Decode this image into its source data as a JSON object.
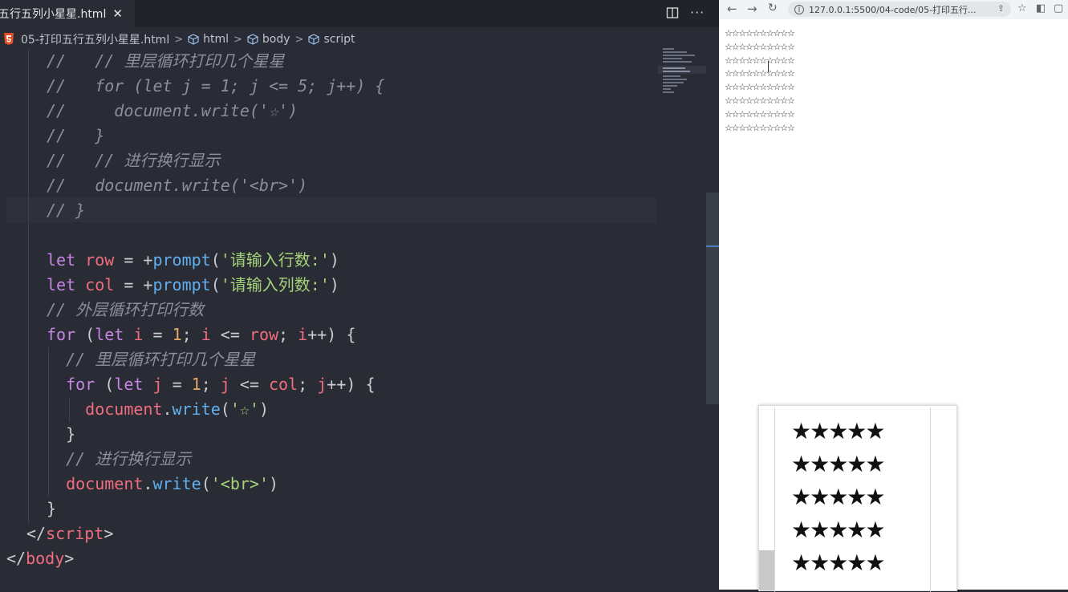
{
  "editor": {
    "tab": {
      "title": "五行五列小星星.html",
      "close": "✕"
    },
    "more": "···",
    "breadcrumb": [
      "05-打印五行五列小星星.html",
      "html",
      "body",
      "script"
    ],
    "code": [
      {
        "parts": [
          [
            "cmt",
            "//   // 里层循环打印几个星星"
          ]
        ]
      },
      {
        "parts": [
          [
            "cmt",
            "//   for (let j = 1; j <= 5; j++) {"
          ]
        ]
      },
      {
        "parts": [
          [
            "cmt",
            "//     document.write('☆')"
          ]
        ]
      },
      {
        "parts": [
          [
            "cmt",
            "//   }"
          ]
        ]
      },
      {
        "parts": [
          [
            "cmt",
            "//   // 进行换行显示"
          ]
        ]
      },
      {
        "parts": [
          [
            "cmt",
            "//   document.write('<br>')"
          ]
        ]
      },
      {
        "parts": [
          [
            "cmt",
            "// }"
          ]
        ]
      },
      {
        "parts": []
      },
      {
        "parts": [
          [
            "kw",
            "let"
          ],
          [
            "op",
            " "
          ],
          [
            "var",
            "row"
          ],
          [
            "op",
            " = +"
          ],
          [
            "fn",
            "prompt"
          ],
          [
            "punc",
            "("
          ],
          [
            "str",
            "'请输入行数:'"
          ],
          [
            "punc",
            ")"
          ]
        ]
      },
      {
        "parts": [
          [
            "kw",
            "let"
          ],
          [
            "op",
            " "
          ],
          [
            "var",
            "col"
          ],
          [
            "op",
            " = +"
          ],
          [
            "fn",
            "prompt"
          ],
          [
            "punc",
            "("
          ],
          [
            "str",
            "'请输入列数:'"
          ],
          [
            "punc",
            ")"
          ]
        ]
      },
      {
        "parts": [
          [
            "cmt",
            "// 外层循环打印行数"
          ]
        ]
      },
      {
        "parts": [
          [
            "kw",
            "for"
          ],
          [
            "punc",
            " ("
          ],
          [
            "kw",
            "let"
          ],
          [
            "op",
            " "
          ],
          [
            "var",
            "i"
          ],
          [
            "op",
            " = "
          ],
          [
            "num",
            "1"
          ],
          [
            "punc",
            "; "
          ],
          [
            "var",
            "i"
          ],
          [
            "op",
            " <= "
          ],
          [
            "var",
            "row"
          ],
          [
            "punc",
            "; "
          ],
          [
            "var",
            "i"
          ],
          [
            "op",
            "++"
          ],
          [
            "punc",
            ") {"
          ]
        ]
      },
      {
        "parts": [
          [
            "cmt",
            "  // 里层循环打印几个星星"
          ]
        ]
      },
      {
        "parts": [
          [
            "op",
            "  "
          ],
          [
            "kw",
            "for"
          ],
          [
            "punc",
            " ("
          ],
          [
            "kw",
            "let"
          ],
          [
            "op",
            " "
          ],
          [
            "var",
            "j"
          ],
          [
            "op",
            " = "
          ],
          [
            "num",
            "1"
          ],
          [
            "punc",
            "; "
          ],
          [
            "var",
            "j"
          ],
          [
            "op",
            " <= "
          ],
          [
            "var",
            "col"
          ],
          [
            "punc",
            "; "
          ],
          [
            "var",
            "j"
          ],
          [
            "op",
            "++"
          ],
          [
            "punc",
            ") {"
          ]
        ]
      },
      {
        "parts": [
          [
            "op",
            "    "
          ],
          [
            "var",
            "document"
          ],
          [
            "punc",
            "."
          ],
          [
            "fn",
            "write"
          ],
          [
            "punc",
            "("
          ],
          [
            "str",
            "'☆'"
          ],
          [
            "punc",
            ")"
          ]
        ]
      },
      {
        "parts": [
          [
            "punc",
            "  }"
          ]
        ]
      },
      {
        "parts": [
          [
            "cmt",
            "  // 进行换行显示"
          ]
        ]
      },
      {
        "parts": [
          [
            "op",
            "  "
          ],
          [
            "var",
            "document"
          ],
          [
            "punc",
            "."
          ],
          [
            "fn",
            "write"
          ],
          [
            "punc",
            "("
          ],
          [
            "str",
            "'<br>'"
          ],
          [
            "punc",
            ")"
          ]
        ]
      },
      {
        "parts": [
          [
            "punc",
            "}"
          ]
        ]
      },
      {
        "parts": [
          [
            "punc",
            "</"
          ],
          [
            "tag",
            "script"
          ],
          [
            "punc",
            ">"
          ]
        ]
      },
      {
        "parts": [
          [
            "punc",
            "</"
          ],
          [
            "tag",
            "body"
          ],
          [
            "punc",
            ">"
          ]
        ]
      }
    ]
  },
  "browser": {
    "url": "127.0.0.1:5500/04-code/05-打印五行...",
    "star_rows": [
      "☆☆☆☆☆☆☆☆☆☆",
      "☆☆☆☆☆☆☆☆☆☆",
      "☆☆☆☆☆☆☆☆☆☆",
      "☆☆☆☆☆☆☆☆☆☆",
      "☆☆☆☆☆☆☆☆☆☆",
      "☆☆☆☆☆☆☆☆☆☆",
      "☆☆☆☆☆☆☆☆☆☆",
      "☆☆☆☆☆☆☆☆☆☆"
    ],
    "preview_rows": [
      "★★★★★",
      "★★★★★",
      "★★★★★",
      "★★★★★",
      "★★★★★"
    ]
  },
  "colors": {
    "editor_bg": "#292c35",
    "keyword": "#c586e3",
    "variable": "#ef6d7e",
    "function": "#61afef",
    "string": "#a6d27a",
    "number": "#e5a767",
    "comment": "#8b8f99"
  },
  "icons": [
    "html5-icon",
    "cube-icon",
    "split-editor-icon",
    "more-icon",
    "back-icon",
    "forward-icon",
    "reload-icon",
    "info-icon",
    "share-icon",
    "bookmark-icon",
    "extension-icon",
    "sidepanel-icon"
  ]
}
